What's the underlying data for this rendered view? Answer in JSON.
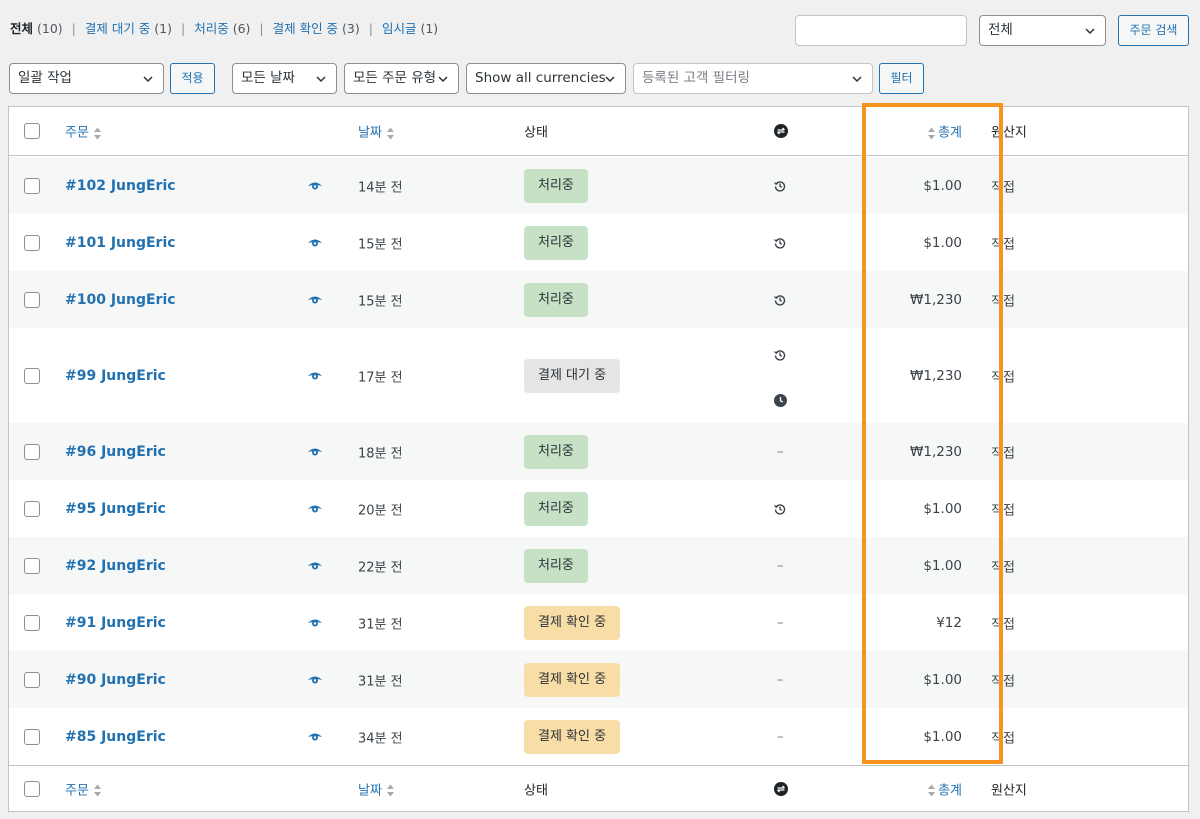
{
  "filters": {
    "all": {
      "label": "전체",
      "count": "(10)"
    },
    "links": [
      {
        "label": "결제 대기 중",
        "count": "(1)"
      },
      {
        "label": "처리중",
        "count": "(6)"
      },
      {
        "label": "결제 확인 중",
        "count": "(3)"
      },
      {
        "label": "임시글",
        "count": "(1)"
      }
    ],
    "separator": "|"
  },
  "search": {
    "input_value": "",
    "scope_select": "전체",
    "button_label": "주문 검색"
  },
  "toolbar": {
    "bulk_action": "일괄 작업",
    "apply_label": "적용",
    "date_filter": "모든 날짜",
    "type_filter": "모든 주문 유형",
    "currency_filter": "Show all currencies",
    "customer_placeholder": "등록된 고객 필터링",
    "filter_label": "필터"
  },
  "columns": {
    "order": "주문",
    "date": "날짜",
    "status": "상태",
    "total": "총계",
    "origin": "원산지"
  },
  "colors": {
    "link": "#2271b1",
    "processing": "#c6e1c6",
    "pending": "#e5e5e5",
    "on_hold": "#f8dda7",
    "highlight": "#f7931e"
  },
  "orders": [
    {
      "order": "#102 JungEric",
      "date": "14분 전",
      "status": "처리중",
      "status_kind": "processing",
      "icons": [
        "history-icon"
      ],
      "total": "$1.00",
      "origin": "직접"
    },
    {
      "order": "#101 JungEric",
      "date": "15분 전",
      "status": "처리중",
      "status_kind": "processing",
      "icons": [
        "history-icon"
      ],
      "total": "$1.00",
      "origin": "직접"
    },
    {
      "order": "#100 JungEric",
      "date": "15분 전",
      "status": "처리중",
      "status_kind": "processing",
      "icons": [
        "history-icon"
      ],
      "total": "₩1,230",
      "origin": "직접"
    },
    {
      "order": "#99 JungEric",
      "date": "17분 전",
      "status": "결제 대기 중",
      "status_kind": "pending",
      "icons": [
        "history-icon",
        "clock-icon"
      ],
      "total": "₩1,230",
      "origin": "직접"
    },
    {
      "order": "#96 JungEric",
      "date": "18분 전",
      "status": "처리중",
      "status_kind": "processing",
      "icons": [],
      "total": "₩1,230",
      "origin": "직접"
    },
    {
      "order": "#95 JungEric",
      "date": "20분 전",
      "status": "처리중",
      "status_kind": "processing",
      "icons": [
        "history-icon"
      ],
      "total": "$1.00",
      "origin": "직접"
    },
    {
      "order": "#92 JungEric",
      "date": "22분 전",
      "status": "처리중",
      "status_kind": "processing",
      "icons": [],
      "total": "$1.00",
      "origin": "직접"
    },
    {
      "order": "#91 JungEric",
      "date": "31분 전",
      "status": "결제 확인 중",
      "status_kind": "on-hold",
      "icons": [],
      "total": "¥12",
      "origin": "직접"
    },
    {
      "order": "#90 JungEric",
      "date": "31분 전",
      "status": "결제 확인 중",
      "status_kind": "on-hold",
      "icons": [],
      "total": "$1.00",
      "origin": "직접"
    },
    {
      "order": "#85 JungEric",
      "date": "34분 전",
      "status": "결제 확인 중",
      "status_kind": "on-hold",
      "icons": [],
      "total": "$1.00",
      "origin": "직접"
    }
  ],
  "empty_marker": "–"
}
